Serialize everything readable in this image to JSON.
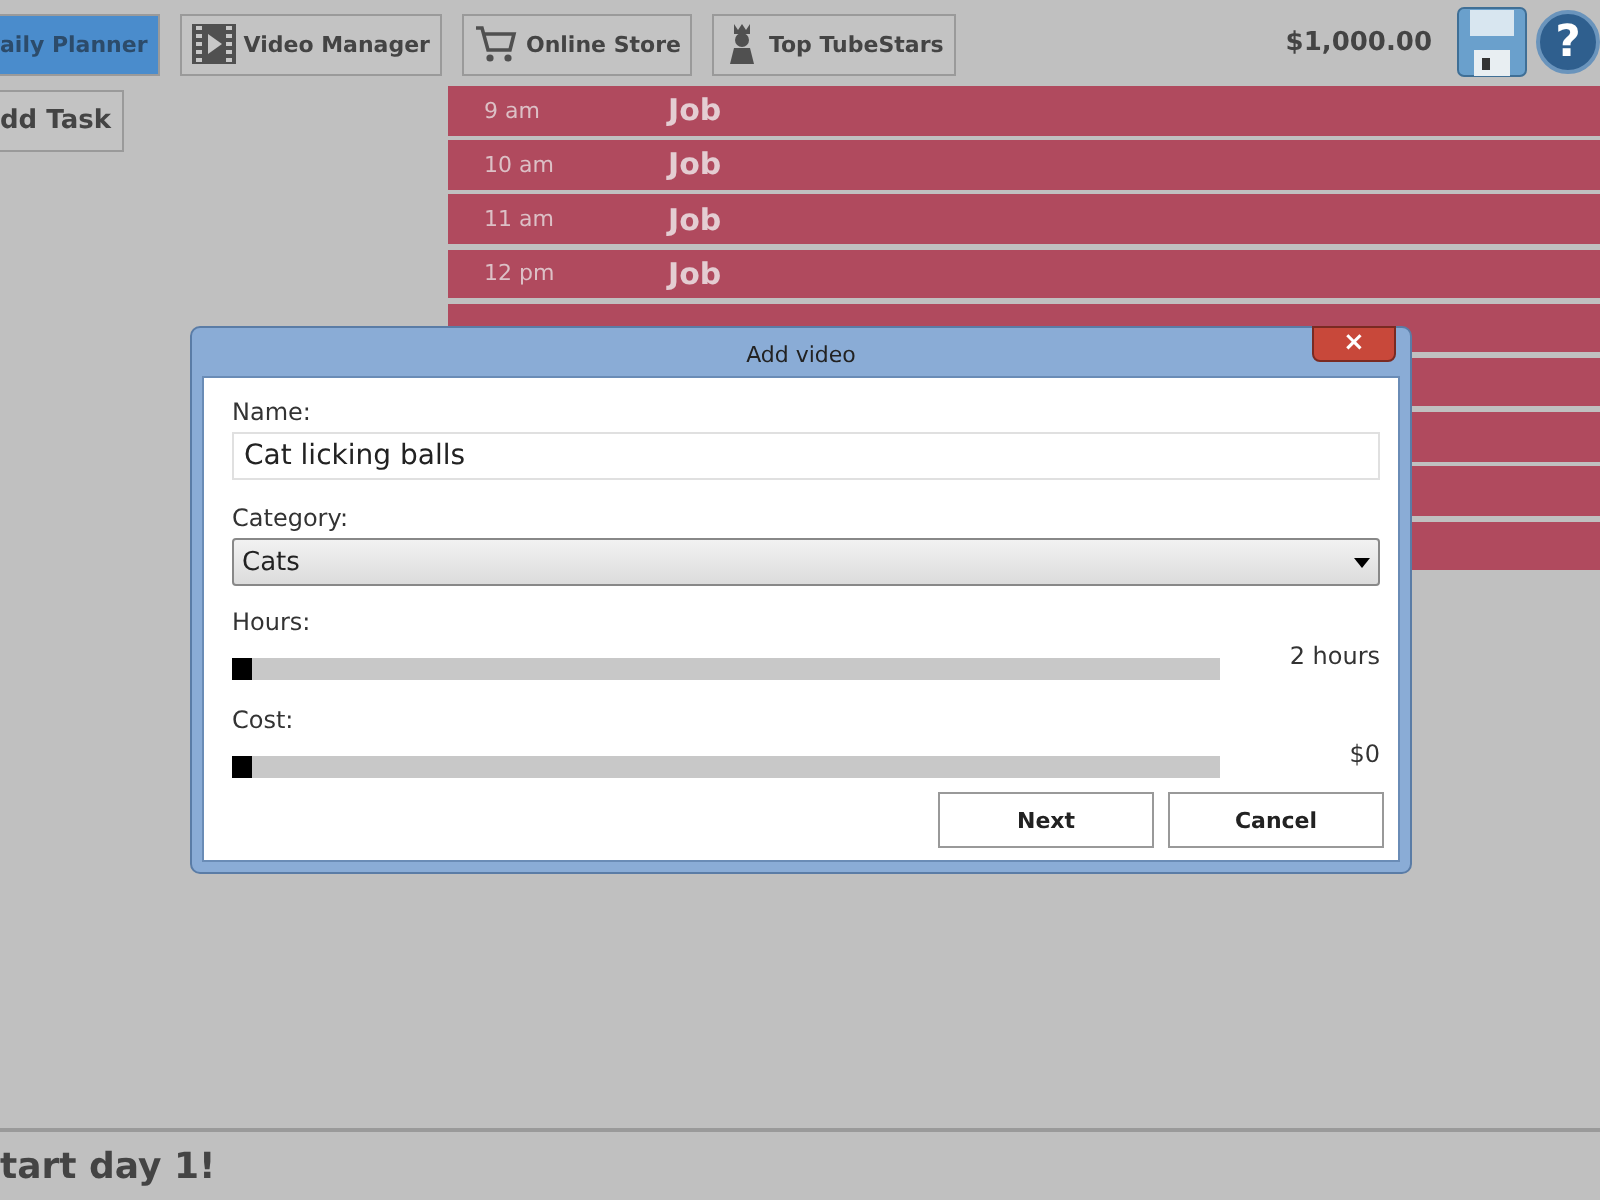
{
  "tabs": [
    {
      "label": "aily Planner",
      "selected": true
    },
    {
      "label": "Video Manager",
      "selected": false
    },
    {
      "label": "Online Store",
      "selected": false
    },
    {
      "label": "Top TubeStars",
      "selected": false
    }
  ],
  "balance": "$1,000.00",
  "help_button": {
    "label": "?"
  },
  "add_task_button": {
    "label": "dd Task"
  },
  "schedule": [
    {
      "time": "9 am",
      "task": "Job"
    },
    {
      "time": "10 am",
      "task": "Job"
    },
    {
      "time": "11 am",
      "task": "Job"
    },
    {
      "time": "12 pm",
      "task": "Job"
    }
  ],
  "status_bar": {
    "text": "tart day 1!"
  },
  "dialog": {
    "title": "Add video",
    "close": "×",
    "name": {
      "label": "Name:",
      "value": "Cat licking balls"
    },
    "category": {
      "label": "Category:",
      "value": "Cats"
    },
    "sliders": [
      {
        "label": "Hours:",
        "level": 0,
        "reading": "2 hours"
      },
      {
        "label": "Cost:",
        "level": 0,
        "reading": "$0"
      }
    ],
    "buttons": [
      "Next",
      "Cancel"
    ]
  }
}
